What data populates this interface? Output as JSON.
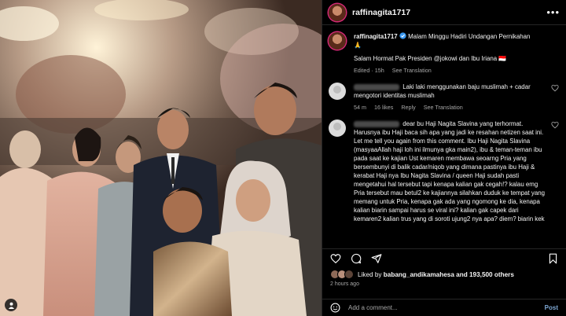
{
  "post": {
    "username": "raffinagita1717",
    "caption_line1": "Malam Minggu Hadiri Undangan Pernikahan",
    "caption_emoji": "🙏",
    "caption_line2": "Salam Hormat Pak Presiden @jokowi dan Ibu Iriana 🇮🇩",
    "edited": "Edited · 15h",
    "see_translation": "See Translation"
  },
  "comments": [
    {
      "text": "Laki laki menggunakan baju muslimah + cadar mengotori identitas muslimah",
      "time": "54 m",
      "likes": "16 likes",
      "reply": "Reply",
      "see_translation": "See Translation"
    },
    {
      "text": "dear bu Haji Nagita Slavina yang terhormat. Harusnya ibu Haji baca sih apa yang jadi ke resahan netizen saat ini. Let me tell you again from this comment. Ibu Haji Nagita Slavina (masyaaAllah haji loh ini ilmunya gka main2), ibu & teman-teman ibu pada saat ke kajian Ust kemaren membawa seoarng Pria yang bersembunyi di balik cadar/niqob yang dimana pastinya ibu Haji & kerabat Haji nya Ibu Nagita Slavina / queen Haji sudah pasti mengetahui hal tersebut tapi kenapa kalian gak cegah!? kalau emg Pria tersebut mau betul2 ke kajiannya silahkan duduk ke tempat yang memang untuk Pria, kenapa gak ada yang ngomong ke dia, kenapa kalian biarin sampai harus se viral ini? kalian gak capek dari kemaren2 kalian trus yang di soroti ujung2 nya apa? diem? biarin kek"
    }
  ],
  "likes": {
    "prefix": "Liked by",
    "user": "babang_andikamahesa",
    "suffix": "and 193,500 others"
  },
  "timestamp": "2 hours ago",
  "composer": {
    "placeholder": "Add a comment...",
    "post_label": "Post"
  },
  "icons": {
    "more": "more-options-icon",
    "heart": "heart-icon",
    "comment": "comment-icon",
    "share": "share-icon",
    "save": "bookmark-icon",
    "emoji": "emoji-icon",
    "tag": "user-tag-icon"
  },
  "colors": {
    "background": "#000000",
    "text": "#f5f5f5",
    "muted": "#a8a8a8",
    "divider": "#262626",
    "post_button": "#7fa9d6"
  }
}
